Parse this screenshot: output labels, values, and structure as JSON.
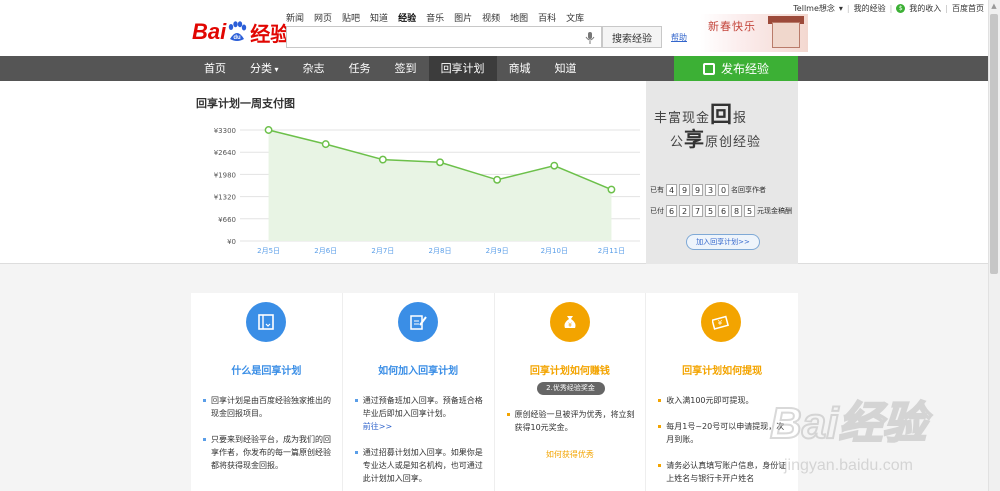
{
  "header": {
    "logo_text": "Bai",
    "logo_du": "du",
    "logo_suffix": "经验",
    "nav": [
      "新闻",
      "网页",
      "贴吧",
      "知道",
      "经验",
      "音乐",
      "图片",
      "视频",
      "地图",
      "百科",
      "文库"
    ],
    "nav_active": "经验",
    "search_value": "",
    "search_button": "搜索经验",
    "help_link": "帮助",
    "banner_text": "新春快乐",
    "user": {
      "name": "Tellme想念",
      "sep": "|",
      "my_exp": "我的经验",
      "income": "我的收入",
      "home": "百度首页"
    }
  },
  "navbar": {
    "items": [
      "首页",
      "分类",
      "杂志",
      "任务",
      "签到",
      "回享计划",
      "商城",
      "知道"
    ],
    "active": "回享计划",
    "publish_label": "发布经验"
  },
  "chart_panel": {
    "title": "回享计划一周支付图"
  },
  "chart_data": {
    "type": "area",
    "title": "回享计划一周支付图",
    "categories": [
      "2月5日",
      "2月6日",
      "2月7日",
      "2月8日",
      "2月9日",
      "2月10日",
      "2月11日"
    ],
    "series": [
      {
        "values": [
          3300,
          2880,
          2420,
          2340,
          1820,
          2240,
          1530
        ]
      }
    ],
    "yticks": [
      "¥0",
      "¥660",
      "¥1320",
      "¥1980",
      "¥2640",
      "¥3300"
    ],
    "ylim": [
      0,
      3300
    ],
    "grid": true,
    "colors": {
      "line": "#6cc04a",
      "fill": "#e8f4e4",
      "grid": "#e3e3e3"
    }
  },
  "ad": {
    "line1": "丰富现金",
    "line1_big": "回",
    "line1_end": "报",
    "line2_pre": "公",
    "line2_big": "享",
    "line2_end": "原创经验",
    "authors_pre": "已有",
    "authors_digits": [
      "4",
      "9",
      "9",
      "3",
      "0"
    ],
    "authors_suffix": "名回享作者",
    "paid_pre": "已付",
    "paid_digits": [
      "6",
      "2",
      "7",
      "5",
      "6",
      "8",
      "5"
    ],
    "paid_suffix": "元现金稿酬",
    "join_label": "加入回享计划>>"
  },
  "cards": [
    {
      "title": "什么是回享计划",
      "color": "#3a8ee6",
      "icon": "book-icon",
      "paras": [
        "回享计划是由百度经验独家推出的现金回报项目。",
        "只要来到经验平台，成为我们的回享作者，你发布的每一篇原创经验都将获得现金回报。"
      ]
    },
    {
      "title": "如何加入回享计划",
      "color": "#3a8ee6",
      "icon": "edit-icon",
      "paras": [
        "通过预备班加入回享。预备班合格毕业后即加入回享计划。",
        "前往>>",
        "通过招募计划加入回享。如果你是专业达人或是知名机构，也可通过此计划加入回享。"
      ]
    },
    {
      "title": "回享计划如何赚钱",
      "color": "#f3a400",
      "icon": "money-bag-icon",
      "badge": "2.优秀经验奖金",
      "paras": [
        "原创经验一旦被评为优秀，将立刻获得10元奖金。"
      ],
      "link": "如何获得优秀"
    },
    {
      "title": "回享计划如何提现",
      "color": "#f3a400",
      "icon": "cash-icon",
      "paras": [
        "收入满100元即可提现。",
        "每月1号~20号可以申请提现，次月到账。",
        "请务必认真填写账户信息，身份证上姓名与银行卡开户姓名"
      ]
    }
  ],
  "watermark": {
    "text": "Bai经验",
    "url": "jingyan.baidu.com"
  }
}
